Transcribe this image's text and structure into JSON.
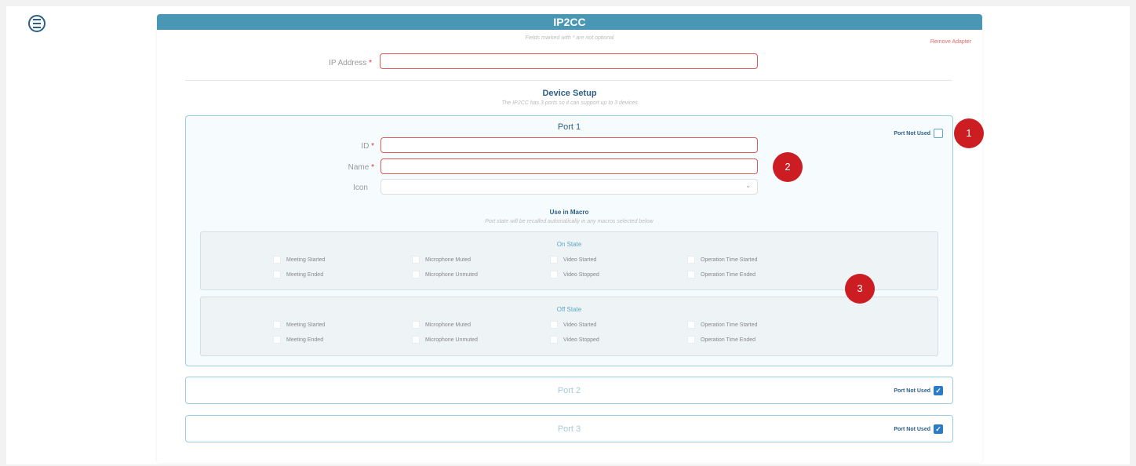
{
  "header": {
    "title": "IP2CC",
    "note": "Fields marked with * are not optional",
    "remove_adapter": "Remove Adapter"
  },
  "ip_address": {
    "label": "IP Address",
    "required_mark": "*",
    "value": ""
  },
  "device_setup": {
    "title": "Device Setup",
    "subtitle": "The IP2CC has 3 ports so it can support up to 3 devices"
  },
  "ports": [
    {
      "title": "Port 1",
      "not_used_label": "Port Not Used",
      "not_used": false,
      "fields": {
        "id": {
          "label": "ID",
          "required_mark": "*",
          "value": ""
        },
        "name": {
          "label": "Name",
          "required_mark": "*",
          "value": ""
        },
        "icon": {
          "label": "Icon",
          "value": ""
        }
      },
      "macro": {
        "title": "Use in Macro",
        "subtitle": "Port state will be recalled automatically in any macros selected below",
        "on_state": {
          "title": "On State",
          "options": [
            "Meeting Started",
            "Microphone Muted",
            "Video Started",
            "Operation Time Started",
            "Meeting Ended",
            "Microphone Unmuted",
            "Video Stopped",
            "Operation Time Ended"
          ]
        },
        "off_state": {
          "title": "Off State",
          "options": [
            "Meeting Started",
            "Microphone Muted",
            "Video Started",
            "Operation Time Started",
            "Meeting Ended",
            "Microphone Unmuted",
            "Video Stopped",
            "Operation Time Ended"
          ]
        }
      }
    },
    {
      "title": "Port 2",
      "not_used_label": "Port Not Used",
      "not_used": true
    },
    {
      "title": "Port 3",
      "not_used_label": "Port Not Used",
      "not_used": true
    }
  ],
  "annotations": [
    "1",
    "2",
    "3"
  ],
  "icons": {
    "menu": "hamburger-circle-icon",
    "select_arrow": "chevron-down-icon",
    "check": "check-icon"
  },
  "colors": {
    "header": "#4a97b5",
    "accent": "#2e5f86",
    "error_border": "#e05a5a",
    "marker": "#cc1d22",
    "checkbox_checked": "#2a7cc7"
  }
}
